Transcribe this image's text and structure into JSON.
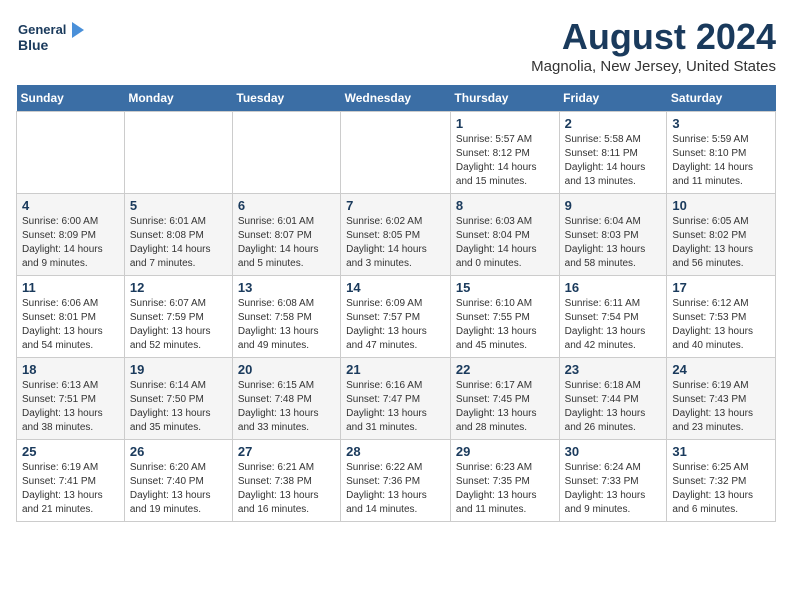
{
  "logo": {
    "line1": "General",
    "line2": "Blue"
  },
  "title": "August 2024",
  "subtitle": "Magnolia, New Jersey, United States",
  "days_of_week": [
    "Sunday",
    "Monday",
    "Tuesday",
    "Wednesday",
    "Thursday",
    "Friday",
    "Saturday"
  ],
  "weeks": [
    [
      {
        "day": "",
        "info": ""
      },
      {
        "day": "",
        "info": ""
      },
      {
        "day": "",
        "info": ""
      },
      {
        "day": "",
        "info": ""
      },
      {
        "day": "1",
        "info": "Sunrise: 5:57 AM\nSunset: 8:12 PM\nDaylight: 14 hours\nand 15 minutes."
      },
      {
        "day": "2",
        "info": "Sunrise: 5:58 AM\nSunset: 8:11 PM\nDaylight: 14 hours\nand 13 minutes."
      },
      {
        "day": "3",
        "info": "Sunrise: 5:59 AM\nSunset: 8:10 PM\nDaylight: 14 hours\nand 11 minutes."
      }
    ],
    [
      {
        "day": "4",
        "info": "Sunrise: 6:00 AM\nSunset: 8:09 PM\nDaylight: 14 hours\nand 9 minutes."
      },
      {
        "day": "5",
        "info": "Sunrise: 6:01 AM\nSunset: 8:08 PM\nDaylight: 14 hours\nand 7 minutes."
      },
      {
        "day": "6",
        "info": "Sunrise: 6:01 AM\nSunset: 8:07 PM\nDaylight: 14 hours\nand 5 minutes."
      },
      {
        "day": "7",
        "info": "Sunrise: 6:02 AM\nSunset: 8:05 PM\nDaylight: 14 hours\nand 3 minutes."
      },
      {
        "day": "8",
        "info": "Sunrise: 6:03 AM\nSunset: 8:04 PM\nDaylight: 14 hours\nand 0 minutes."
      },
      {
        "day": "9",
        "info": "Sunrise: 6:04 AM\nSunset: 8:03 PM\nDaylight: 13 hours\nand 58 minutes."
      },
      {
        "day": "10",
        "info": "Sunrise: 6:05 AM\nSunset: 8:02 PM\nDaylight: 13 hours\nand 56 minutes."
      }
    ],
    [
      {
        "day": "11",
        "info": "Sunrise: 6:06 AM\nSunset: 8:01 PM\nDaylight: 13 hours\nand 54 minutes."
      },
      {
        "day": "12",
        "info": "Sunrise: 6:07 AM\nSunset: 7:59 PM\nDaylight: 13 hours\nand 52 minutes."
      },
      {
        "day": "13",
        "info": "Sunrise: 6:08 AM\nSunset: 7:58 PM\nDaylight: 13 hours\nand 49 minutes."
      },
      {
        "day": "14",
        "info": "Sunrise: 6:09 AM\nSunset: 7:57 PM\nDaylight: 13 hours\nand 47 minutes."
      },
      {
        "day": "15",
        "info": "Sunrise: 6:10 AM\nSunset: 7:55 PM\nDaylight: 13 hours\nand 45 minutes."
      },
      {
        "day": "16",
        "info": "Sunrise: 6:11 AM\nSunset: 7:54 PM\nDaylight: 13 hours\nand 42 minutes."
      },
      {
        "day": "17",
        "info": "Sunrise: 6:12 AM\nSunset: 7:53 PM\nDaylight: 13 hours\nand 40 minutes."
      }
    ],
    [
      {
        "day": "18",
        "info": "Sunrise: 6:13 AM\nSunset: 7:51 PM\nDaylight: 13 hours\nand 38 minutes."
      },
      {
        "day": "19",
        "info": "Sunrise: 6:14 AM\nSunset: 7:50 PM\nDaylight: 13 hours\nand 35 minutes."
      },
      {
        "day": "20",
        "info": "Sunrise: 6:15 AM\nSunset: 7:48 PM\nDaylight: 13 hours\nand 33 minutes."
      },
      {
        "day": "21",
        "info": "Sunrise: 6:16 AM\nSunset: 7:47 PM\nDaylight: 13 hours\nand 31 minutes."
      },
      {
        "day": "22",
        "info": "Sunrise: 6:17 AM\nSunset: 7:45 PM\nDaylight: 13 hours\nand 28 minutes."
      },
      {
        "day": "23",
        "info": "Sunrise: 6:18 AM\nSunset: 7:44 PM\nDaylight: 13 hours\nand 26 minutes."
      },
      {
        "day": "24",
        "info": "Sunrise: 6:19 AM\nSunset: 7:43 PM\nDaylight: 13 hours\nand 23 minutes."
      }
    ],
    [
      {
        "day": "25",
        "info": "Sunrise: 6:19 AM\nSunset: 7:41 PM\nDaylight: 13 hours\nand 21 minutes."
      },
      {
        "day": "26",
        "info": "Sunrise: 6:20 AM\nSunset: 7:40 PM\nDaylight: 13 hours\nand 19 minutes."
      },
      {
        "day": "27",
        "info": "Sunrise: 6:21 AM\nSunset: 7:38 PM\nDaylight: 13 hours\nand 16 minutes."
      },
      {
        "day": "28",
        "info": "Sunrise: 6:22 AM\nSunset: 7:36 PM\nDaylight: 13 hours\nand 14 minutes."
      },
      {
        "day": "29",
        "info": "Sunrise: 6:23 AM\nSunset: 7:35 PM\nDaylight: 13 hours\nand 11 minutes."
      },
      {
        "day": "30",
        "info": "Sunrise: 6:24 AM\nSunset: 7:33 PM\nDaylight: 13 hours\nand 9 minutes."
      },
      {
        "day": "31",
        "info": "Sunrise: 6:25 AM\nSunset: 7:32 PM\nDaylight: 13 hours\nand 6 minutes."
      }
    ]
  ]
}
